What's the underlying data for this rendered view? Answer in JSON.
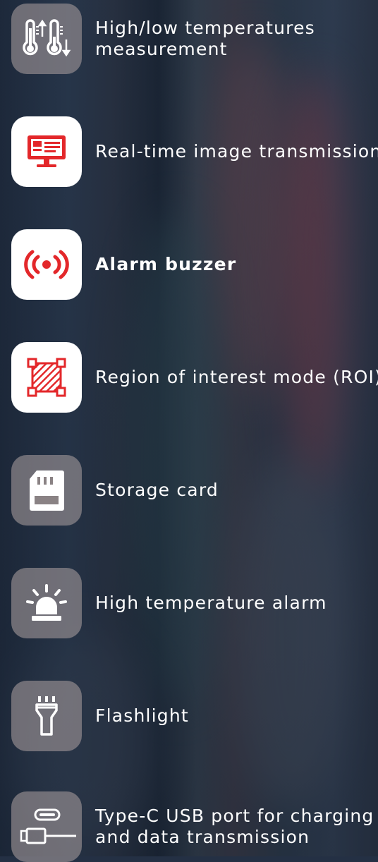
{
  "features": [
    {
      "label_lines": [
        "High/low temperatures",
        "measurement"
      ],
      "icon": "thermometer-high-low-icon",
      "tile": "gray"
    },
    {
      "label_lines": [
        "Real-time image transmission"
      ],
      "icon": "monitor-icon",
      "tile": "white"
    },
    {
      "label_lines": [
        "Alarm buzzer"
      ],
      "icon": "buzzer-signal-icon",
      "tile": "white",
      "bold": true
    },
    {
      "label_lines": [
        "Region of interest mode (ROI)"
      ],
      "icon": "roi-region-icon",
      "tile": "white"
    },
    {
      "label_lines": [
        "Storage card"
      ],
      "icon": "sd-card-icon",
      "tile": "gray"
    },
    {
      "label_lines": [
        "High temperature alarm"
      ],
      "icon": "alarm-light-icon",
      "tile": "gray"
    },
    {
      "label_lines": [
        "Flashlight"
      ],
      "icon": "flashlight-icon",
      "tile": "gray"
    },
    {
      "label_lines": [
        "Type-C USB port for charging",
        "and data transmission"
      ],
      "icon": "usb-c-cable-icon",
      "tile": "gray"
    }
  ],
  "colors": {
    "accent_red": "#e3272a",
    "tile_gray": "#a09698",
    "tile_white": "#ffffff",
    "text": "#ffffff"
  }
}
